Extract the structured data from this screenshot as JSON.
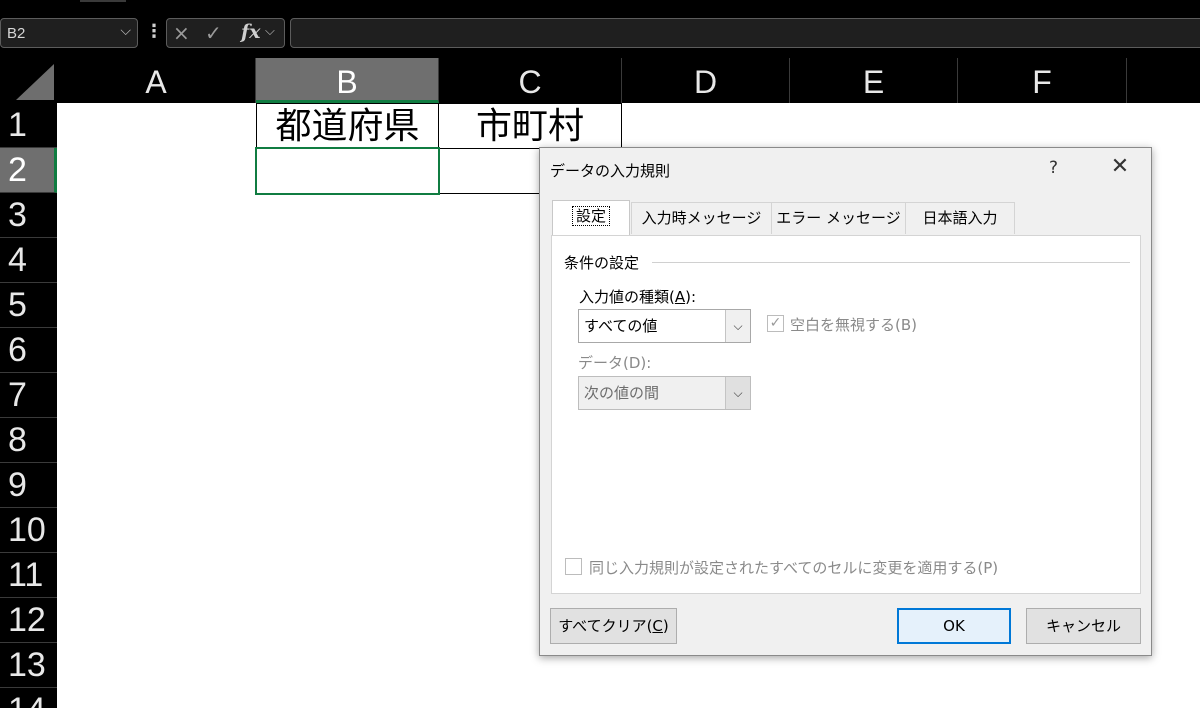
{
  "formula_bar": {
    "name_box": "B2",
    "cancel_icon": "×",
    "enter_icon": "✓",
    "fx_label": "fx",
    "formula_value": ""
  },
  "sheet": {
    "columns": [
      "A",
      "B",
      "C",
      "D",
      "E",
      "F"
    ],
    "selected_column": "B",
    "rows": [
      "1",
      "2",
      "3",
      "4",
      "5",
      "6",
      "7",
      "8",
      "9",
      "10",
      "11",
      "12",
      "13",
      "14"
    ],
    "selected_row": "2",
    "cells": {
      "B1": "都道府県",
      "C1": "市町村",
      "B2": ""
    },
    "colors": {
      "selection": "#107c41",
      "header_bg": "#000000",
      "header_selected_bg": "#6f6f6f"
    }
  },
  "dialog": {
    "title": "データの入力規則",
    "help_icon": "?",
    "close_icon": "✕",
    "tabs": [
      "設定",
      "入力時メッセージ",
      "エラー メッセージ",
      "日本語入力"
    ],
    "active_tab": "設定",
    "settings": {
      "group_label": "条件の設定",
      "allow_label_pre": "入力値の種類(",
      "allow_label_key": "A",
      "allow_label_post": "):",
      "allow_value": "すべての値",
      "ignore_blank_label": "空白を無視する(B)",
      "ignore_blank_checked": true,
      "data_label": "データ(D):",
      "data_value": "次の値の間",
      "apply_all_label": "同じ入力規則が設定されたすべてのセルに変更を適用する(P)",
      "apply_all_checked": false
    },
    "buttons": {
      "clear_all_pre": "すべてクリア(",
      "clear_all_key": "C",
      "clear_all_post": ")",
      "ok": "OK",
      "cancel": "キャンセル"
    }
  }
}
